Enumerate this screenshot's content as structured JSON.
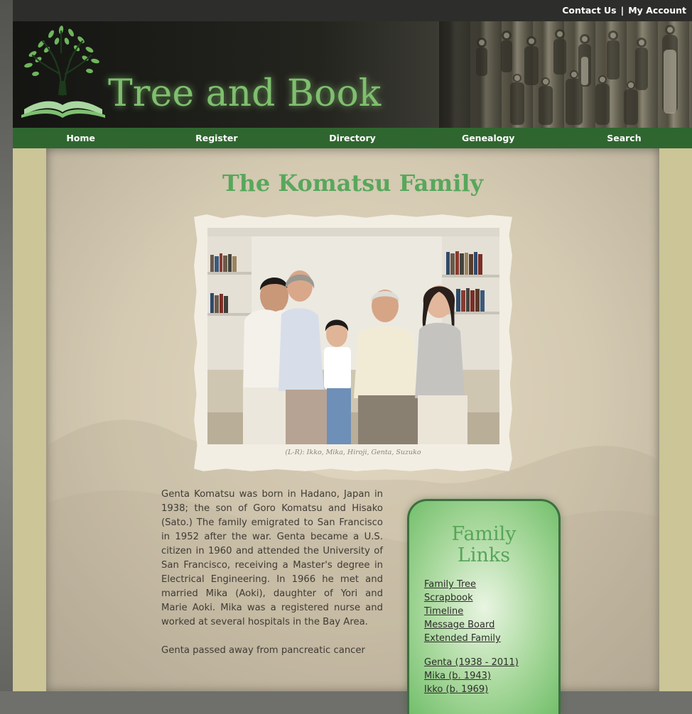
{
  "topbar": {
    "contact": "Contact Us",
    "separator": "|",
    "account": "My Account"
  },
  "header": {
    "site_title": "Tree and Book"
  },
  "nav": {
    "items": [
      "Home",
      "Register",
      "Directory",
      "Genealogy",
      "Search"
    ]
  },
  "main": {
    "title": "The Komatsu Family",
    "photo_caption": "(L-R): Ikko, Mika, Hiroji, Genta, Suzuko",
    "bio": [
      "Genta Komatsu was born in Hadano, Japan in 1938; the son of Goro Komatsu and Hisako (Sato.) The family emigrated to San Francisco in 1952 after the war. Genta became a U.S. citizen in 1960 and attended the University of San Francisco, receiving a Master's degree in Electrical Engineering. In 1966 he met and married Mika (Aoki), daughter of Yori and Marie Aoki. Mika was a registered nurse and worked at several hospitals in the Bay Area.",
      "Genta passed away from pancreatic cancer"
    ]
  },
  "family_links": {
    "title_line1": "Family",
    "title_line2": "Links",
    "links": [
      "Family Tree",
      "Scrapbook",
      "Timeline",
      "Message Board",
      "Extended Family"
    ],
    "members": [
      "Genta (1938 - 2011)",
      "Mika (b. 1943)",
      "Ikko (b. 1969)"
    ]
  },
  "colors": {
    "nav_green": "#2f6630",
    "title_green": "#58a75c",
    "logo_green": "#7fbf6e",
    "topbar": "#2d2d2b"
  }
}
